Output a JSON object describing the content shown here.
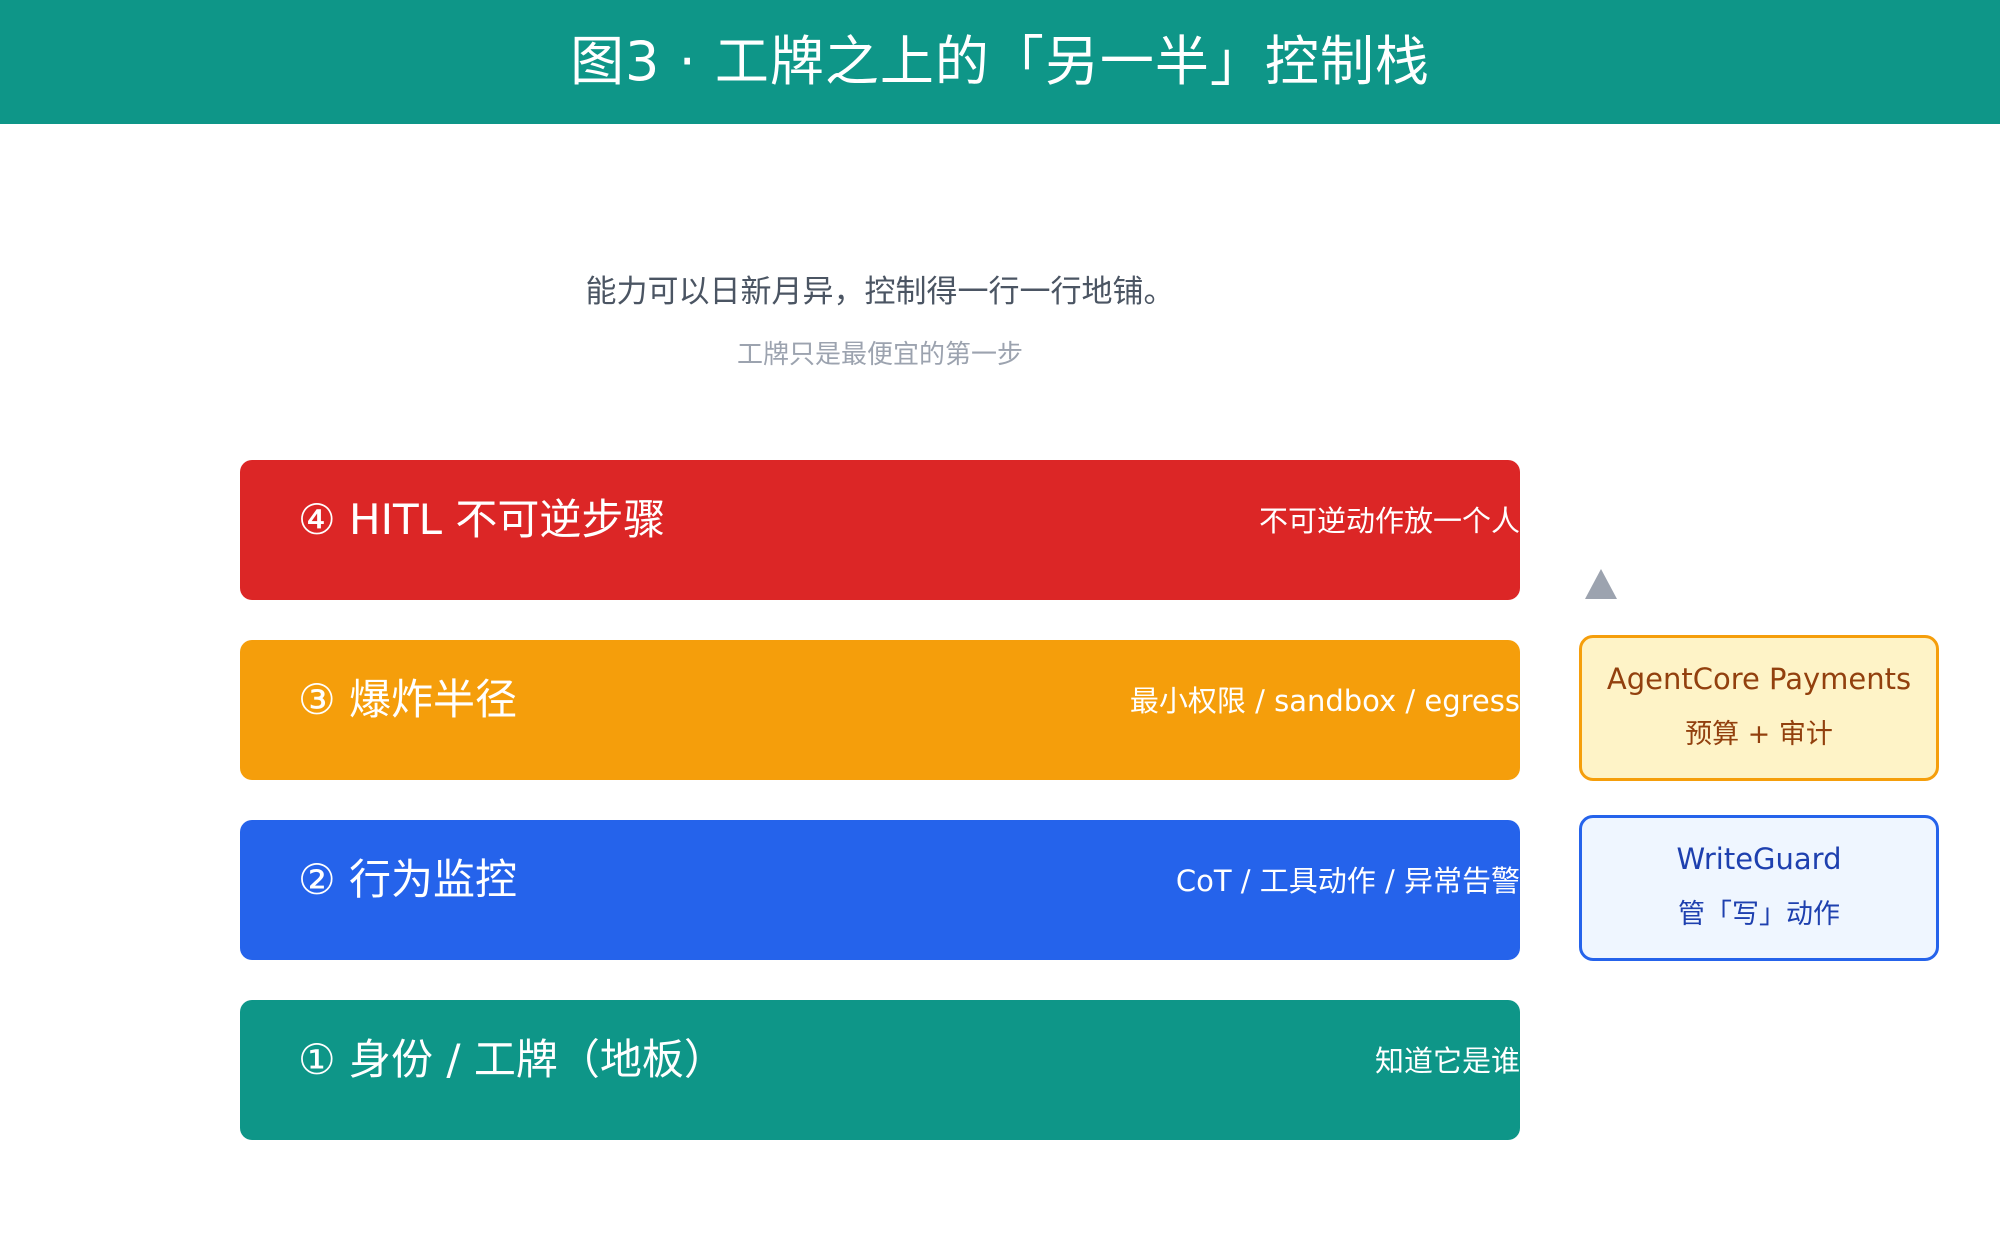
{
  "header": {
    "title": "图3 · 工牌之上的「另一半」控制栈"
  },
  "intro": {
    "main": "能力可以日新月异，控制得一行一行地铺。",
    "sub": "工牌只是最便宜的第一步"
  },
  "layers": [
    {
      "label": "④ HITL 不可逆步骤",
      "note": "不可逆动作放一个人",
      "color": "#dc2626"
    },
    {
      "label": "③ 爆炸半径",
      "note": "最小权限 / sandbox / egress",
      "color": "#f59e0b"
    },
    {
      "label": "② 行为监控",
      "note": "CoT / 工具动作 / 异常告警",
      "color": "#2563eb"
    },
    {
      "label": "① 身份 / 工牌（地板）",
      "note": "知道它是谁",
      "color": "#0e9688"
    }
  ],
  "side_cards": [
    {
      "title": "AgentCore Payments",
      "sub": "预算 + 审计",
      "border": "#f59e0b",
      "fill": "#fef3c7"
    },
    {
      "title": "WriteGuard",
      "sub": "管「写」动作",
      "border": "#2563eb",
      "fill": "#eff6ff"
    }
  ],
  "icons": {
    "stack_arrow": "up-triangle-icon"
  }
}
